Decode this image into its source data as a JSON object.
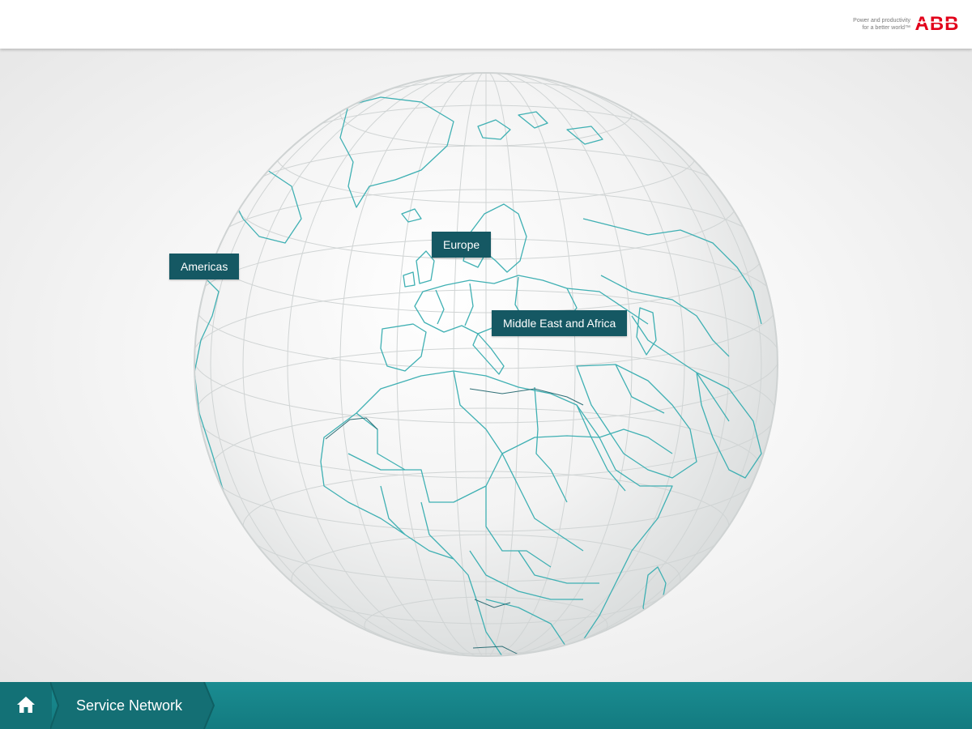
{
  "header": {
    "tagline_line1": "Power and productivity",
    "tagline_line2": "for a better world™",
    "logo_text": "ABB",
    "brand_color": "#e2001a"
  },
  "map": {
    "regions": [
      {
        "label": "Americas"
      },
      {
        "label": "Europe"
      },
      {
        "label": "Middle East and Africa"
      }
    ],
    "label_color": "#155863",
    "coast_color": "#3fb0b3"
  },
  "footer": {
    "home_icon": "home-icon",
    "breadcrumb": "Service Network",
    "bar_color": "#16868b"
  }
}
